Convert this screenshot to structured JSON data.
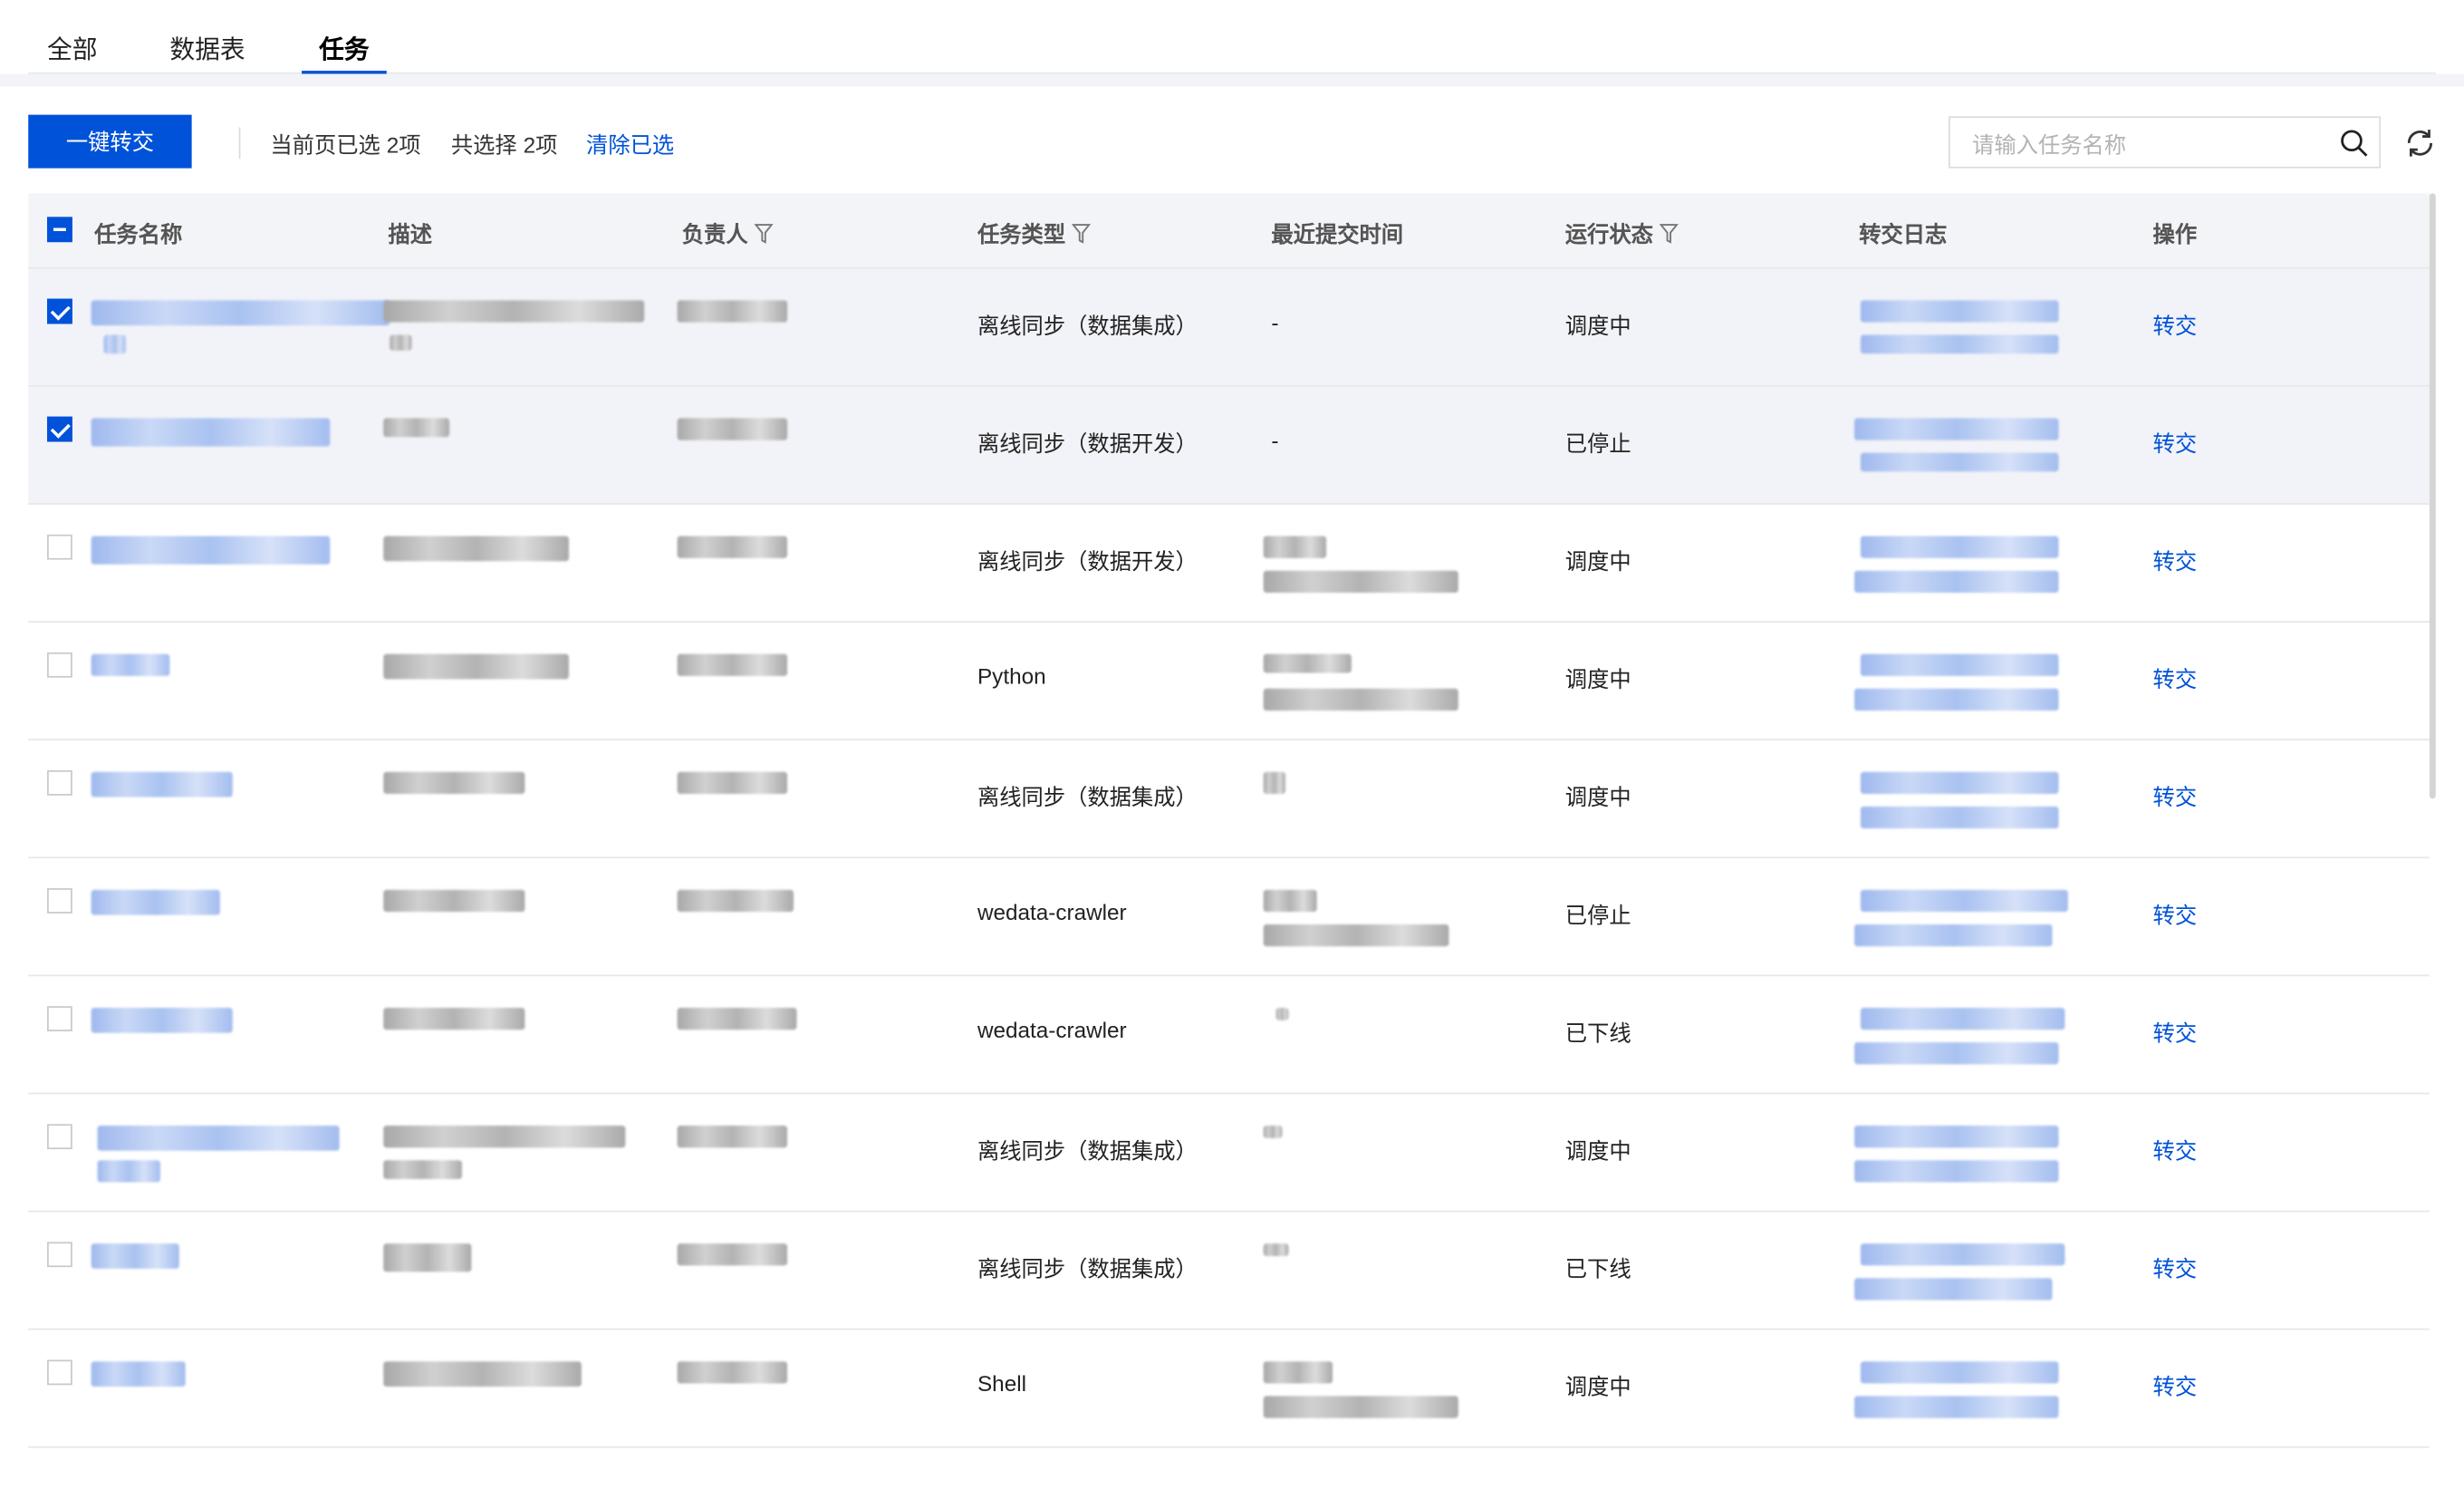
{
  "tabs": [
    {
      "label": "全部",
      "active": false
    },
    {
      "label": "数据表",
      "active": false
    },
    {
      "label": "任务",
      "active": true
    }
  ],
  "toolbar": {
    "transfer_button": "一键转交",
    "page_selected": "当前页已选",
    "page_selected_count": "2项",
    "total_selected": "共选择",
    "total_selected_count": "2项",
    "clear_selection": "清除已选"
  },
  "search": {
    "placeholder": "请输入任务名称"
  },
  "table": {
    "columns": {
      "name": "任务名称",
      "desc": "描述",
      "owner": "负责人",
      "type": "任务类型",
      "submit_time": "最近提交时间",
      "status": "运行状态",
      "log": "转交日志",
      "action": "操作"
    },
    "rows": [
      {
        "selected": true,
        "type": "离线同步（数据集成）",
        "submit_time": "-",
        "status": "调度中",
        "action": "转交"
      },
      {
        "selected": true,
        "type": "离线同步（数据开发）",
        "submit_time": "-",
        "status": "已停止",
        "action": "转交"
      },
      {
        "selected": false,
        "type": "离线同步（数据开发）",
        "submit_time": "",
        "status": "调度中",
        "action": "转交"
      },
      {
        "selected": false,
        "type": "Python",
        "submit_time": "",
        "status": "调度中",
        "action": "转交"
      },
      {
        "selected": false,
        "type": "离线同步（数据集成）",
        "submit_time": "",
        "status": "调度中",
        "action": "转交"
      },
      {
        "selected": false,
        "type": "wedata-crawler",
        "submit_time": "",
        "status": "已停止",
        "action": "转交"
      },
      {
        "selected": false,
        "type": "wedata-crawler",
        "submit_time": "",
        "status": "已下线",
        "action": "转交"
      },
      {
        "selected": false,
        "type": "离线同步（数据集成）",
        "submit_time": "",
        "status": "调度中",
        "action": "转交"
      },
      {
        "selected": false,
        "type": "离线同步（数据集成）",
        "submit_time": "",
        "status": "已下线",
        "action": "转交"
      },
      {
        "selected": false,
        "type": "Shell",
        "submit_time": "",
        "status": "调度中",
        "action": "转交"
      }
    ]
  },
  "colors": {
    "primary": "#0052d9",
    "header_bg": "#f3f4f7",
    "selected_row_bg": "#f2f3f8"
  },
  "icons": {
    "search": "search-icon",
    "refresh": "refresh-icon",
    "filter": "filter-icon"
  }
}
